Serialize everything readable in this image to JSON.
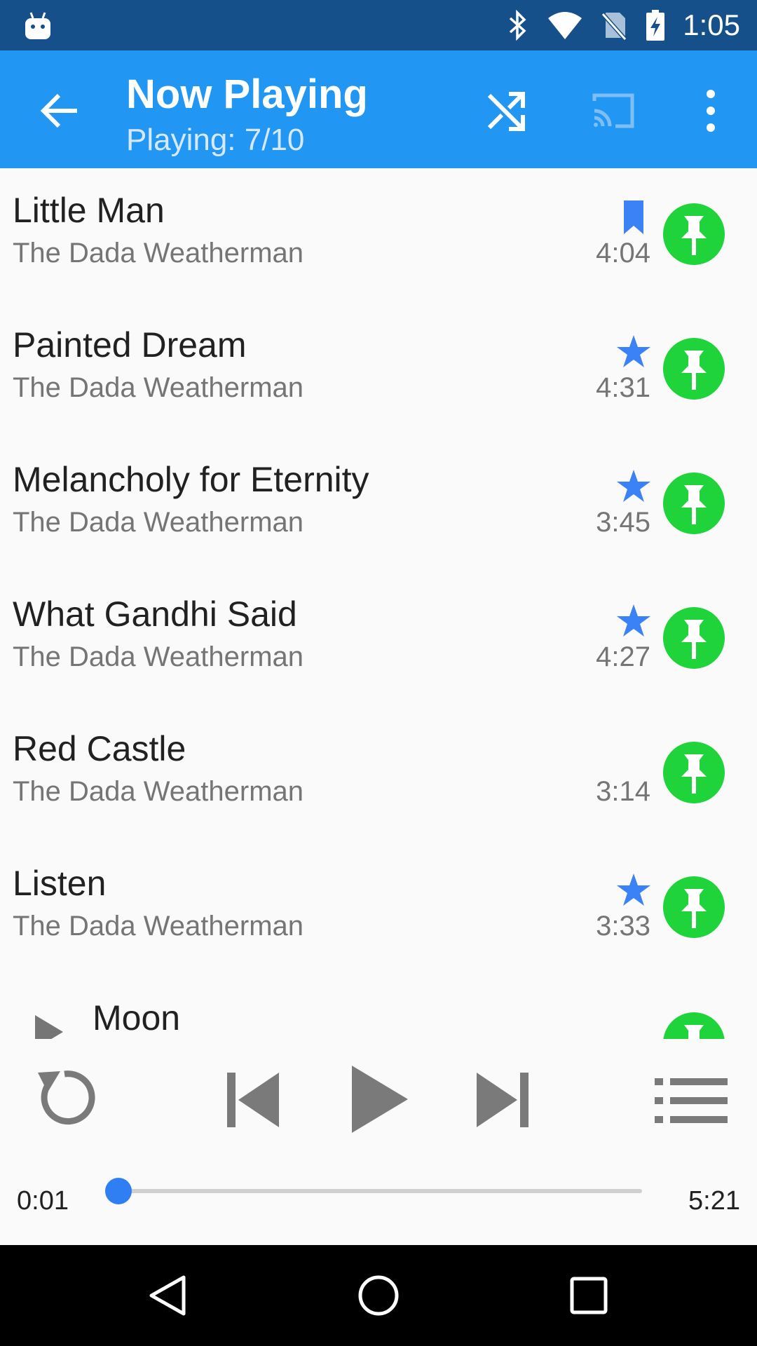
{
  "status_bar": {
    "time": "1:05",
    "icons": [
      "bluetooth-icon",
      "wifi-icon",
      "no-sim-icon",
      "battery-charging-icon"
    ]
  },
  "app_bar": {
    "title": "Now Playing",
    "subtitle": "Playing: 7/10",
    "actions": [
      "shuffle-icon",
      "cast-icon",
      "overflow-menu-icon"
    ]
  },
  "playlist": {
    "items": [
      {
        "title": "Little Man",
        "artist": "The Dada Weatherman",
        "duration": "4:04",
        "badge": "bookmark"
      },
      {
        "title": "Painted Dream",
        "artist": "The Dada Weatherman",
        "duration": "4:31",
        "badge": "star"
      },
      {
        "title": "Melancholy for Eternity",
        "artist": "The Dada Weatherman",
        "duration": "3:45",
        "badge": "star"
      },
      {
        "title": "What Gandhi Said",
        "artist": "The Dada Weatherman",
        "duration": "4:27",
        "badge": "star"
      },
      {
        "title": "Red Castle",
        "artist": "The Dada Weatherman",
        "duration": "3:14",
        "badge": ""
      },
      {
        "title": "Listen",
        "artist": "The Dada Weatherman",
        "duration": "3:33",
        "badge": "star"
      }
    ],
    "current": {
      "title": "Moon"
    }
  },
  "player": {
    "elapsed": "0:01",
    "total": "5:21",
    "progress_fraction": 0.003
  },
  "colors": {
    "status_bar": "#15508a",
    "app_bar": "#2196f3",
    "accent": "#2f7ef2",
    "pin": "#1ed43a"
  }
}
